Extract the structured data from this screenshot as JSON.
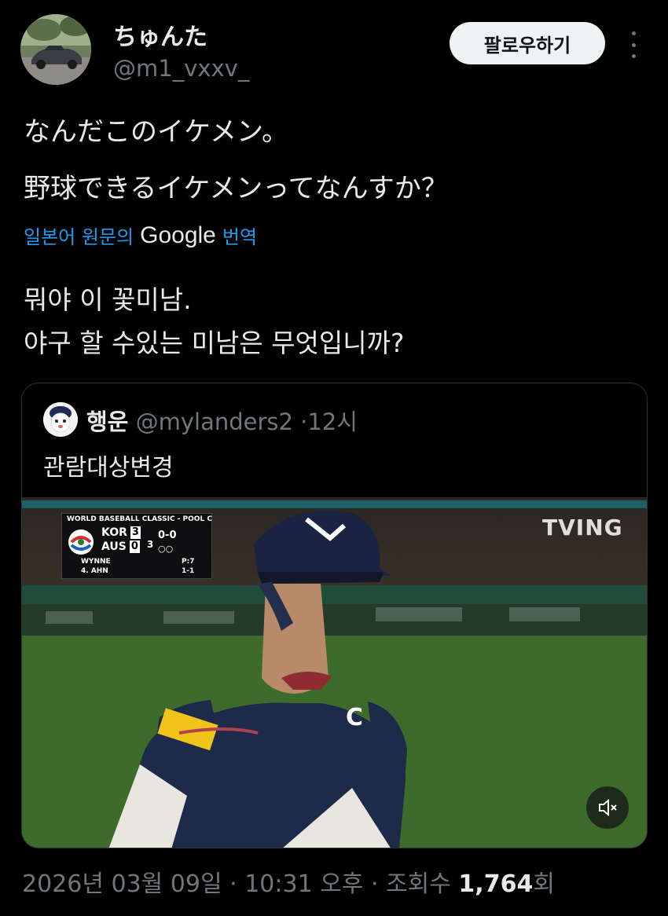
{
  "author": {
    "display_name": "ちゅんた",
    "handle": "@m1_vxxv_"
  },
  "actions": {
    "follow_label": "팔로우하기",
    "more_icon": "more-vertical-icon"
  },
  "tweet": {
    "line1": "なんだこのイケメン。",
    "line2": "野球できるイケメンってなんすか？"
  },
  "translation": {
    "prefix": "일본어 원문의",
    "google": "Google",
    "suffix": "번역",
    "line1": "뭐야 이 꽃미남.",
    "line2": "야구 할 수있는 미남은 무엇입니까?"
  },
  "quote": {
    "display_name": "행운",
    "handle": "@mylanders2",
    "separator": "·",
    "time": "12시",
    "text": "관람대상변경"
  },
  "media": {
    "scorebug": {
      "title": "WORLD BASEBALL CLASSIC - POOL C",
      "team1": "KOR",
      "score1": "3",
      "team2": "AUS",
      "score2": "0",
      "inning": "3",
      "count": "0-0",
      "outs": "○○",
      "pitcher": "WYNNE",
      "pitch_count": "P:7",
      "batter": "4. AHN",
      "batter_stat": "1-1"
    },
    "broadcaster": "TVING",
    "jersey_letter": "C",
    "mute_icon": "speaker-muted-icon"
  },
  "footer": {
    "date": "2026년 03월 09일",
    "sep1": "·",
    "time": "10:31 오후",
    "sep2": "·",
    "views_label": "조회수",
    "views_count": "1,764",
    "views_suffix": "회"
  }
}
